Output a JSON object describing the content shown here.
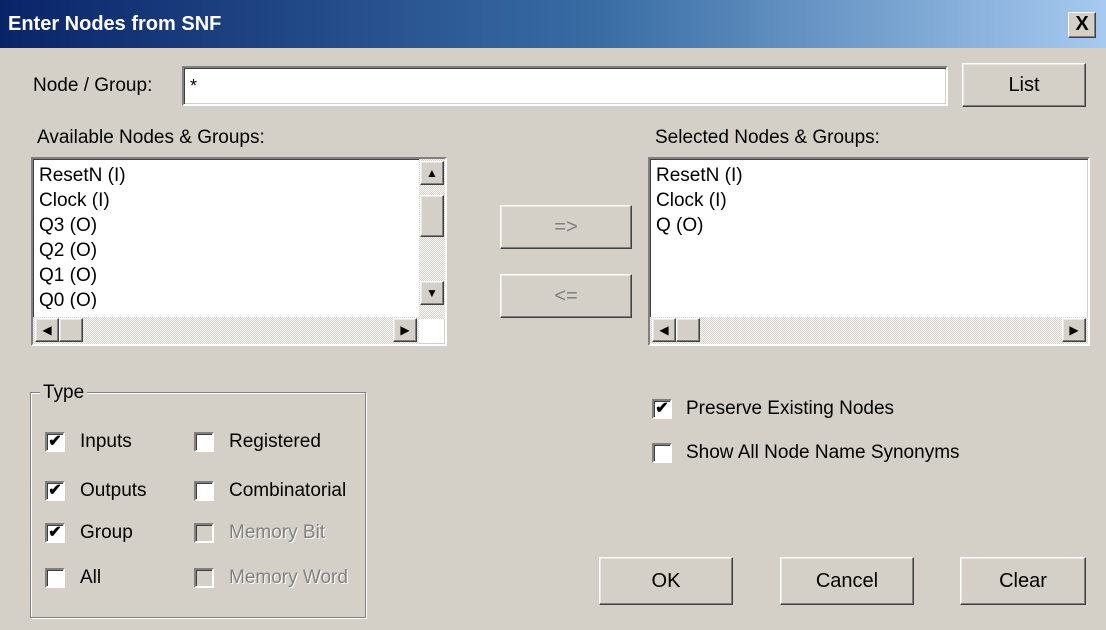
{
  "window": {
    "title": "Enter Nodes from SNF",
    "close_glyph": "X"
  },
  "node_group": {
    "label": "Node / Group:",
    "value": "*",
    "list_button": "List"
  },
  "available": {
    "label": "Available Nodes & Groups:",
    "items": [
      "ResetN (I)",
      "Clock (I)",
      "Q3 (O)",
      "Q2 (O)",
      "Q1 (O)",
      "Q0 (O)"
    ]
  },
  "selected": {
    "label": "Selected Nodes & Groups:",
    "items": [
      "ResetN (I)",
      "Clock (I)",
      "Q (O)"
    ]
  },
  "transfer": {
    "add_label": "=>",
    "remove_label": "<="
  },
  "type_group": {
    "label": "Type",
    "inputs": {
      "label": "Inputs",
      "checked": true
    },
    "outputs": {
      "label": "Outputs",
      "checked": true
    },
    "group": {
      "label": "Group",
      "checked": true
    },
    "all": {
      "label": "All",
      "checked": false
    },
    "registered": {
      "label": "Registered",
      "checked": false
    },
    "combinatorial": {
      "label": "Combinatorial",
      "checked": false
    },
    "memory_bit": {
      "label": "Memory Bit",
      "checked": false,
      "disabled": true
    },
    "memory_word": {
      "label": "Memory Word",
      "checked": false,
      "disabled": true
    }
  },
  "options": {
    "preserve": {
      "label": "Preserve Existing Nodes",
      "checked": true
    },
    "synonyms": {
      "label": "Show All Node Name Synonyms",
      "checked": false
    }
  },
  "buttons": {
    "ok": "OK",
    "cancel": "Cancel",
    "clear": "Clear"
  },
  "colors": {
    "face": "#d4d0c8",
    "title_start": "#0a246a",
    "title_end": "#a6caf0"
  },
  "check_glyph": "✔"
}
